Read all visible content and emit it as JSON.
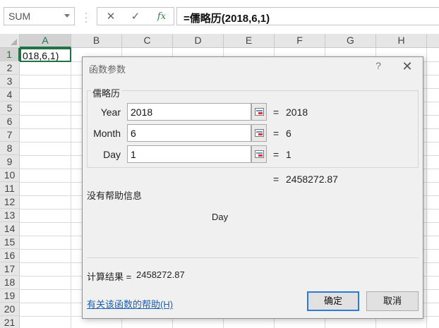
{
  "formula_bar": {
    "name_box": "SUM",
    "cancel_icon": "✕",
    "enter_icon": "✓",
    "fx_label": "fx",
    "formula": "=儒略历(2018,6,1)"
  },
  "grid": {
    "columns": [
      "A",
      "B",
      "C",
      "D",
      "E",
      "F",
      "G",
      "H"
    ],
    "rows": [
      "1",
      "2",
      "3",
      "4",
      "5",
      "6",
      "7",
      "8",
      "9",
      "10",
      "11",
      "12",
      "13",
      "14",
      "15",
      "16",
      "17",
      "18",
      "19",
      "20",
      "21"
    ],
    "active_cell_text": "018,6,1)"
  },
  "dialog": {
    "title": "函数参数",
    "help_icon": "?",
    "close_icon": "✕",
    "function_name": "儒略历",
    "args": [
      {
        "label": "Year",
        "value": "2018",
        "result": "2018"
      },
      {
        "label": "Month",
        "value": "6",
        "result": "6"
      },
      {
        "label": "Day",
        "value": "1",
        "result": "1"
      }
    ],
    "equals": "=",
    "formula_result": "2458272.87",
    "no_help_text": "没有帮助信息",
    "current_arg_name": "Day",
    "calc_result_label": "计算结果 =",
    "calc_result_value": "2458272.87",
    "help_link": "有关该函数的帮助(H)",
    "ok_button": "确定",
    "cancel_button": "取消"
  },
  "colors": {
    "accent": "#217346",
    "link": "#1a5fb4",
    "focus": "#2d7ad6"
  }
}
